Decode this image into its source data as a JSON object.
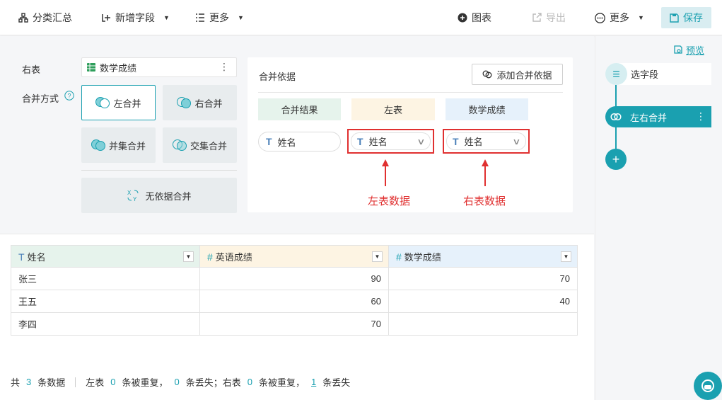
{
  "toolbar": {
    "group_summary": "分类汇总",
    "add_field": "新增字段",
    "more_left": "更多",
    "chart": "图表",
    "export": "导出",
    "more_right": "更多",
    "save": "保存"
  },
  "config": {
    "right_table_label": "右表",
    "right_table_value": "数学成绩",
    "merge_mode_label": "合并方式",
    "modes": [
      {
        "label": "左合并",
        "active": true
      },
      {
        "label": "右合并",
        "active": false
      },
      {
        "label": "并集合并",
        "active": false
      },
      {
        "label": "交集合并",
        "active": false
      }
    ],
    "no_basis_merge": "无依据合并"
  },
  "basis": {
    "title": "合并依据",
    "add_button": "添加合并依据",
    "columns": [
      "合并结果",
      "左表",
      "数学成绩"
    ],
    "result_field": "姓名",
    "left_field": "姓名",
    "right_field": "姓名",
    "annotation_left": "左表数据",
    "annotation_right": "右表数据"
  },
  "steps": {
    "preview": "预览",
    "items": [
      "选字段",
      "左右合并"
    ]
  },
  "table": {
    "headers": [
      "姓名",
      "英语成绩",
      "数学成绩"
    ],
    "rows": [
      [
        "张三",
        "90",
        "70"
      ],
      [
        "王五",
        "60",
        "40"
      ],
      [
        "李四",
        "70",
        ""
      ]
    ]
  },
  "summary": {
    "prefix": "共",
    "total": "3",
    "total_suffix": "条数据",
    "left_label": "左表",
    "left_dup": "0",
    "dup_text": "条被重复，",
    "left_lost": "0",
    "lost_text_left": "条丢失；右表",
    "right_dup": "0",
    "right_dup_text": "条被重复，",
    "right_lost": "1",
    "lost_text_right": "条丢失"
  },
  "colors": {
    "accent": "#1aa0b0",
    "annotation": "#e03030",
    "hdr_result": "#e6f3ec",
    "hdr_left": "#fdf4e3",
    "hdr_right": "#e6f1fb"
  }
}
